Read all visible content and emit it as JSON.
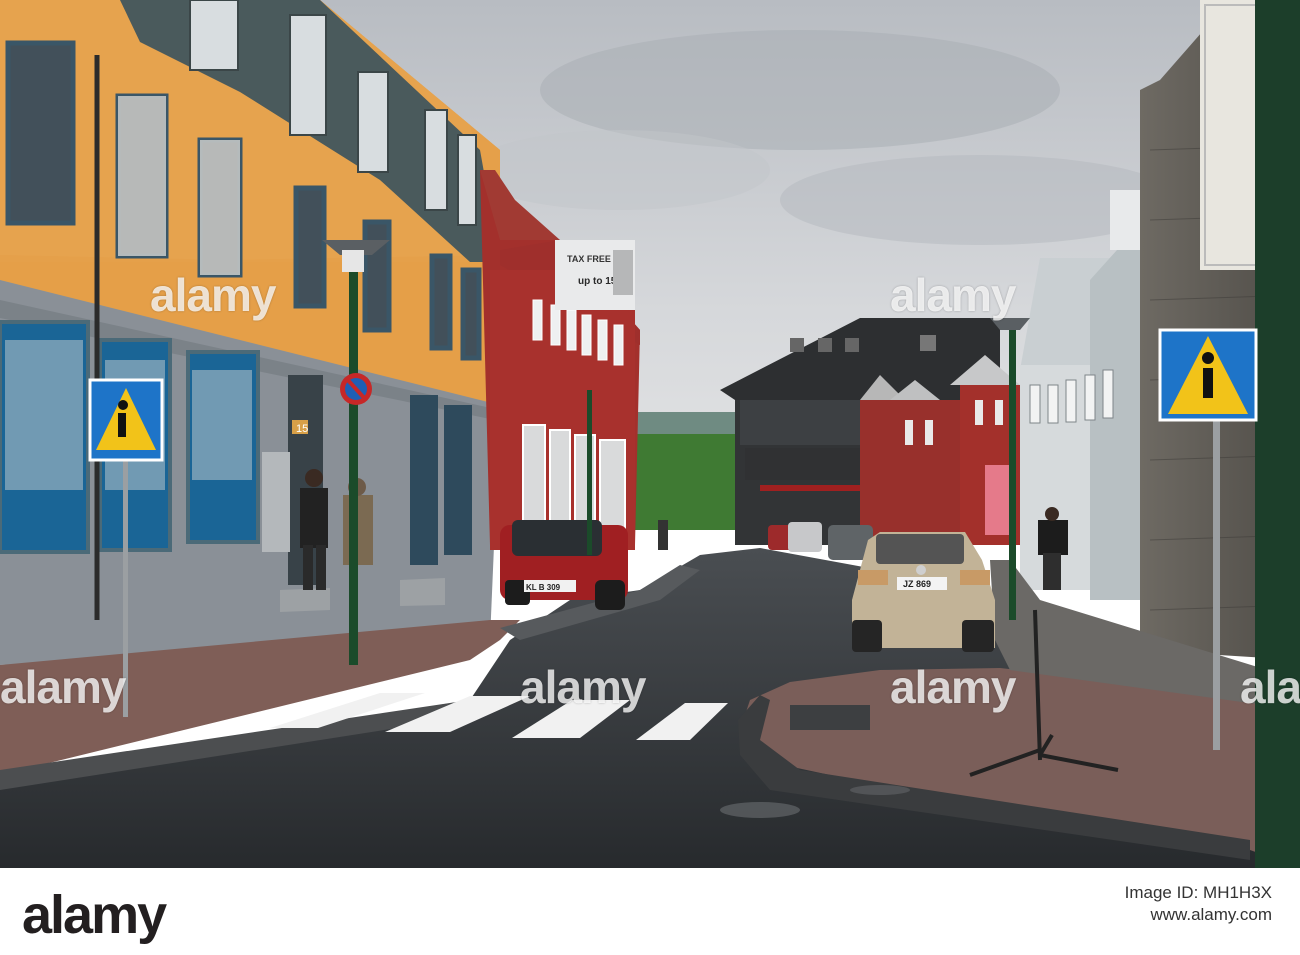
{
  "watermarks": {
    "text": "alamy",
    "count": 6
  },
  "footer": {
    "logo": "alamy",
    "image_id_line": "Image ID: MH1H3X",
    "url": "www.alamy.com"
  },
  "scene": {
    "sign_number": "15",
    "plate_left": "KL B 309",
    "plate_right": "JZ 869",
    "billboard_brand": "TAX FREE",
    "billboard_text": "up to 15%"
  },
  "colors": {
    "sky": "#c9ccd0",
    "yellow_building": "#e39f4d",
    "red_building": "#a8312d",
    "asphalt": "#2f3235",
    "sign_blue": "#1e74c8",
    "sign_yellow": "#f2c319"
  }
}
